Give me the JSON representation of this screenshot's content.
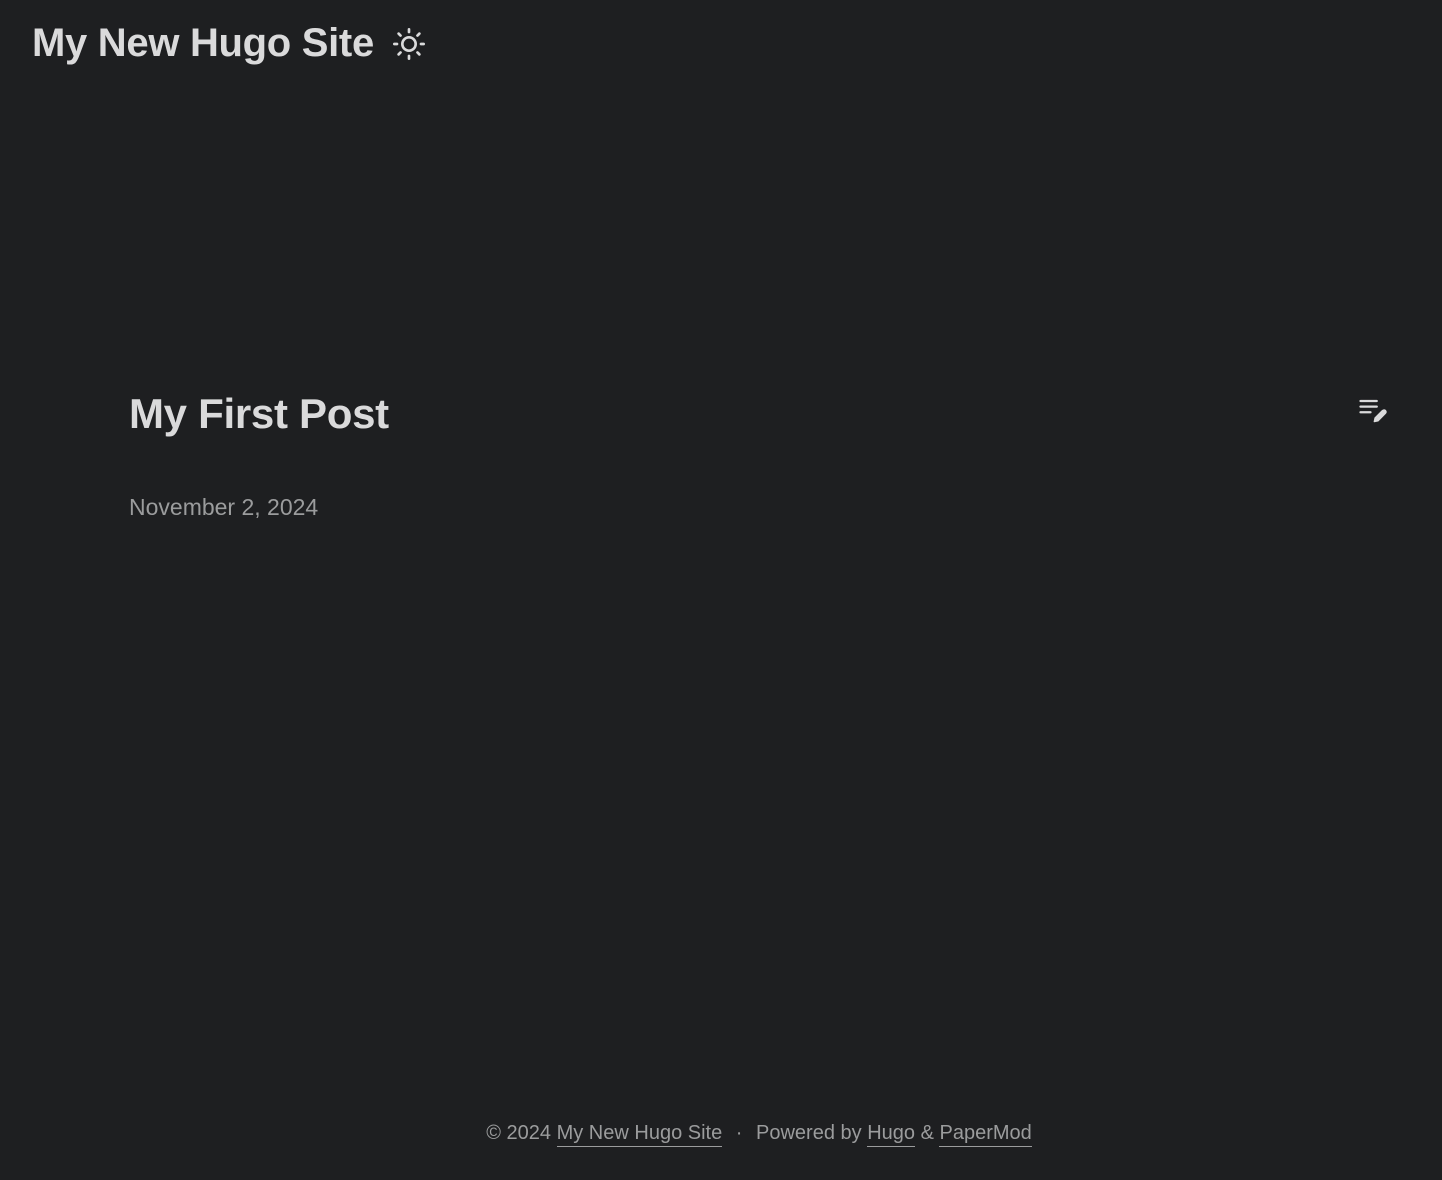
{
  "header": {
    "site_title": "My New Hugo Site",
    "theme_toggle_icon": "sun-icon"
  },
  "post": {
    "title": "My First Post",
    "date": "November 2, 2024",
    "edit_icon": "edit-list-icon"
  },
  "footer": {
    "copyright": "© 2024",
    "site_link": "My New Hugo Site",
    "separator": "·",
    "powered_by": "Powered by",
    "hugo_link": "Hugo",
    "ampersand": "&",
    "theme_link": "PaperMod"
  },
  "colors": {
    "background": "#1e1f21",
    "primary_text": "#dadadb",
    "secondary_text": "#9b9c9d"
  }
}
